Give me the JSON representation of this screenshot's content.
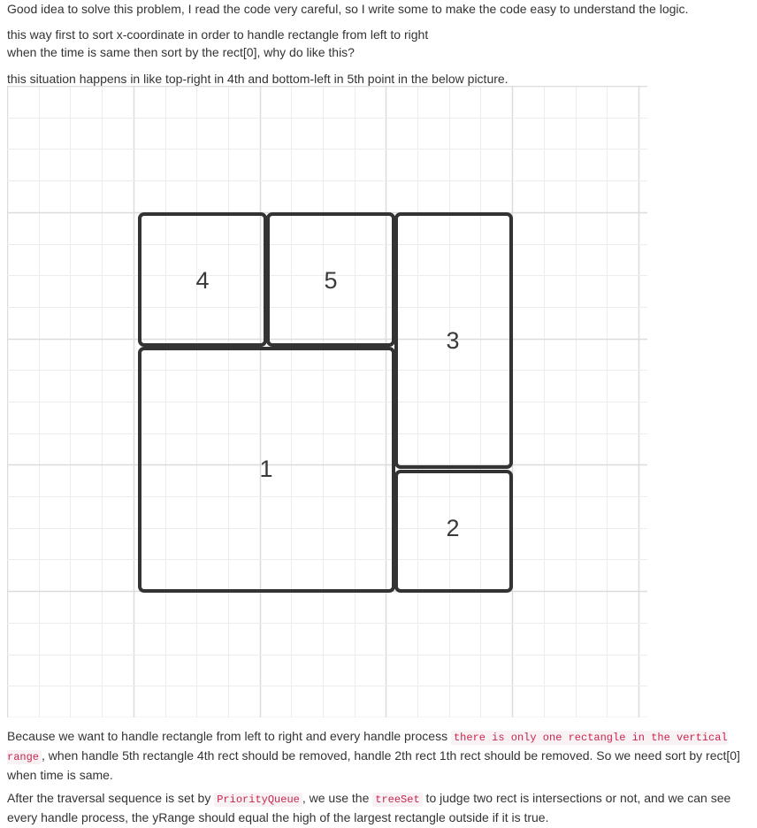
{
  "post": {
    "intro": "Good idea to solve this problem, I read the code very careful, so I write some to make the code easy to understand the logic.",
    "para2_line1": "this way first to sort x-coordinate in order to handle rectangle from left to right",
    "para2_line2": "when the time is same then sort by the rect[0], why do like this?",
    "para3": "this situation happens in like top-right in 4th and bottom-left in 5th point in the below picture.",
    "para4_before_code": "Because we want to handle rectangle from left to right and every handle process ",
    "para4_code": "there is only one rectangle in the vertical range",
    "para4_after_code": ", when handle 5th rectangle 4th rect should be removed, handle 2th rect 1th rect should be removed. So we need sort by rect[0] when time is same.",
    "para5_before_code1": "After the traversal sequence is set by ",
    "para5_code1": "PriorityQueue",
    "para5_between": ", we use the ",
    "para5_code2": "treeSet",
    "para5_after_code2": " to judge two rect is intersections or not, and we can see every handle process, the yRange should equal the high of the largest rectangle outside if it is true."
  },
  "figure": {
    "labels": {
      "rect1": "1",
      "rect2": "2",
      "rect3": "3",
      "rect4": "4",
      "rect5": "5"
    }
  },
  "colors": {
    "text": "#333333",
    "code_text": "#c7254e",
    "code_bg": "#f9f2f4",
    "grid_minor": "#ececec",
    "grid_major": "#dcdcdc",
    "rect_stroke": "#333333"
  }
}
